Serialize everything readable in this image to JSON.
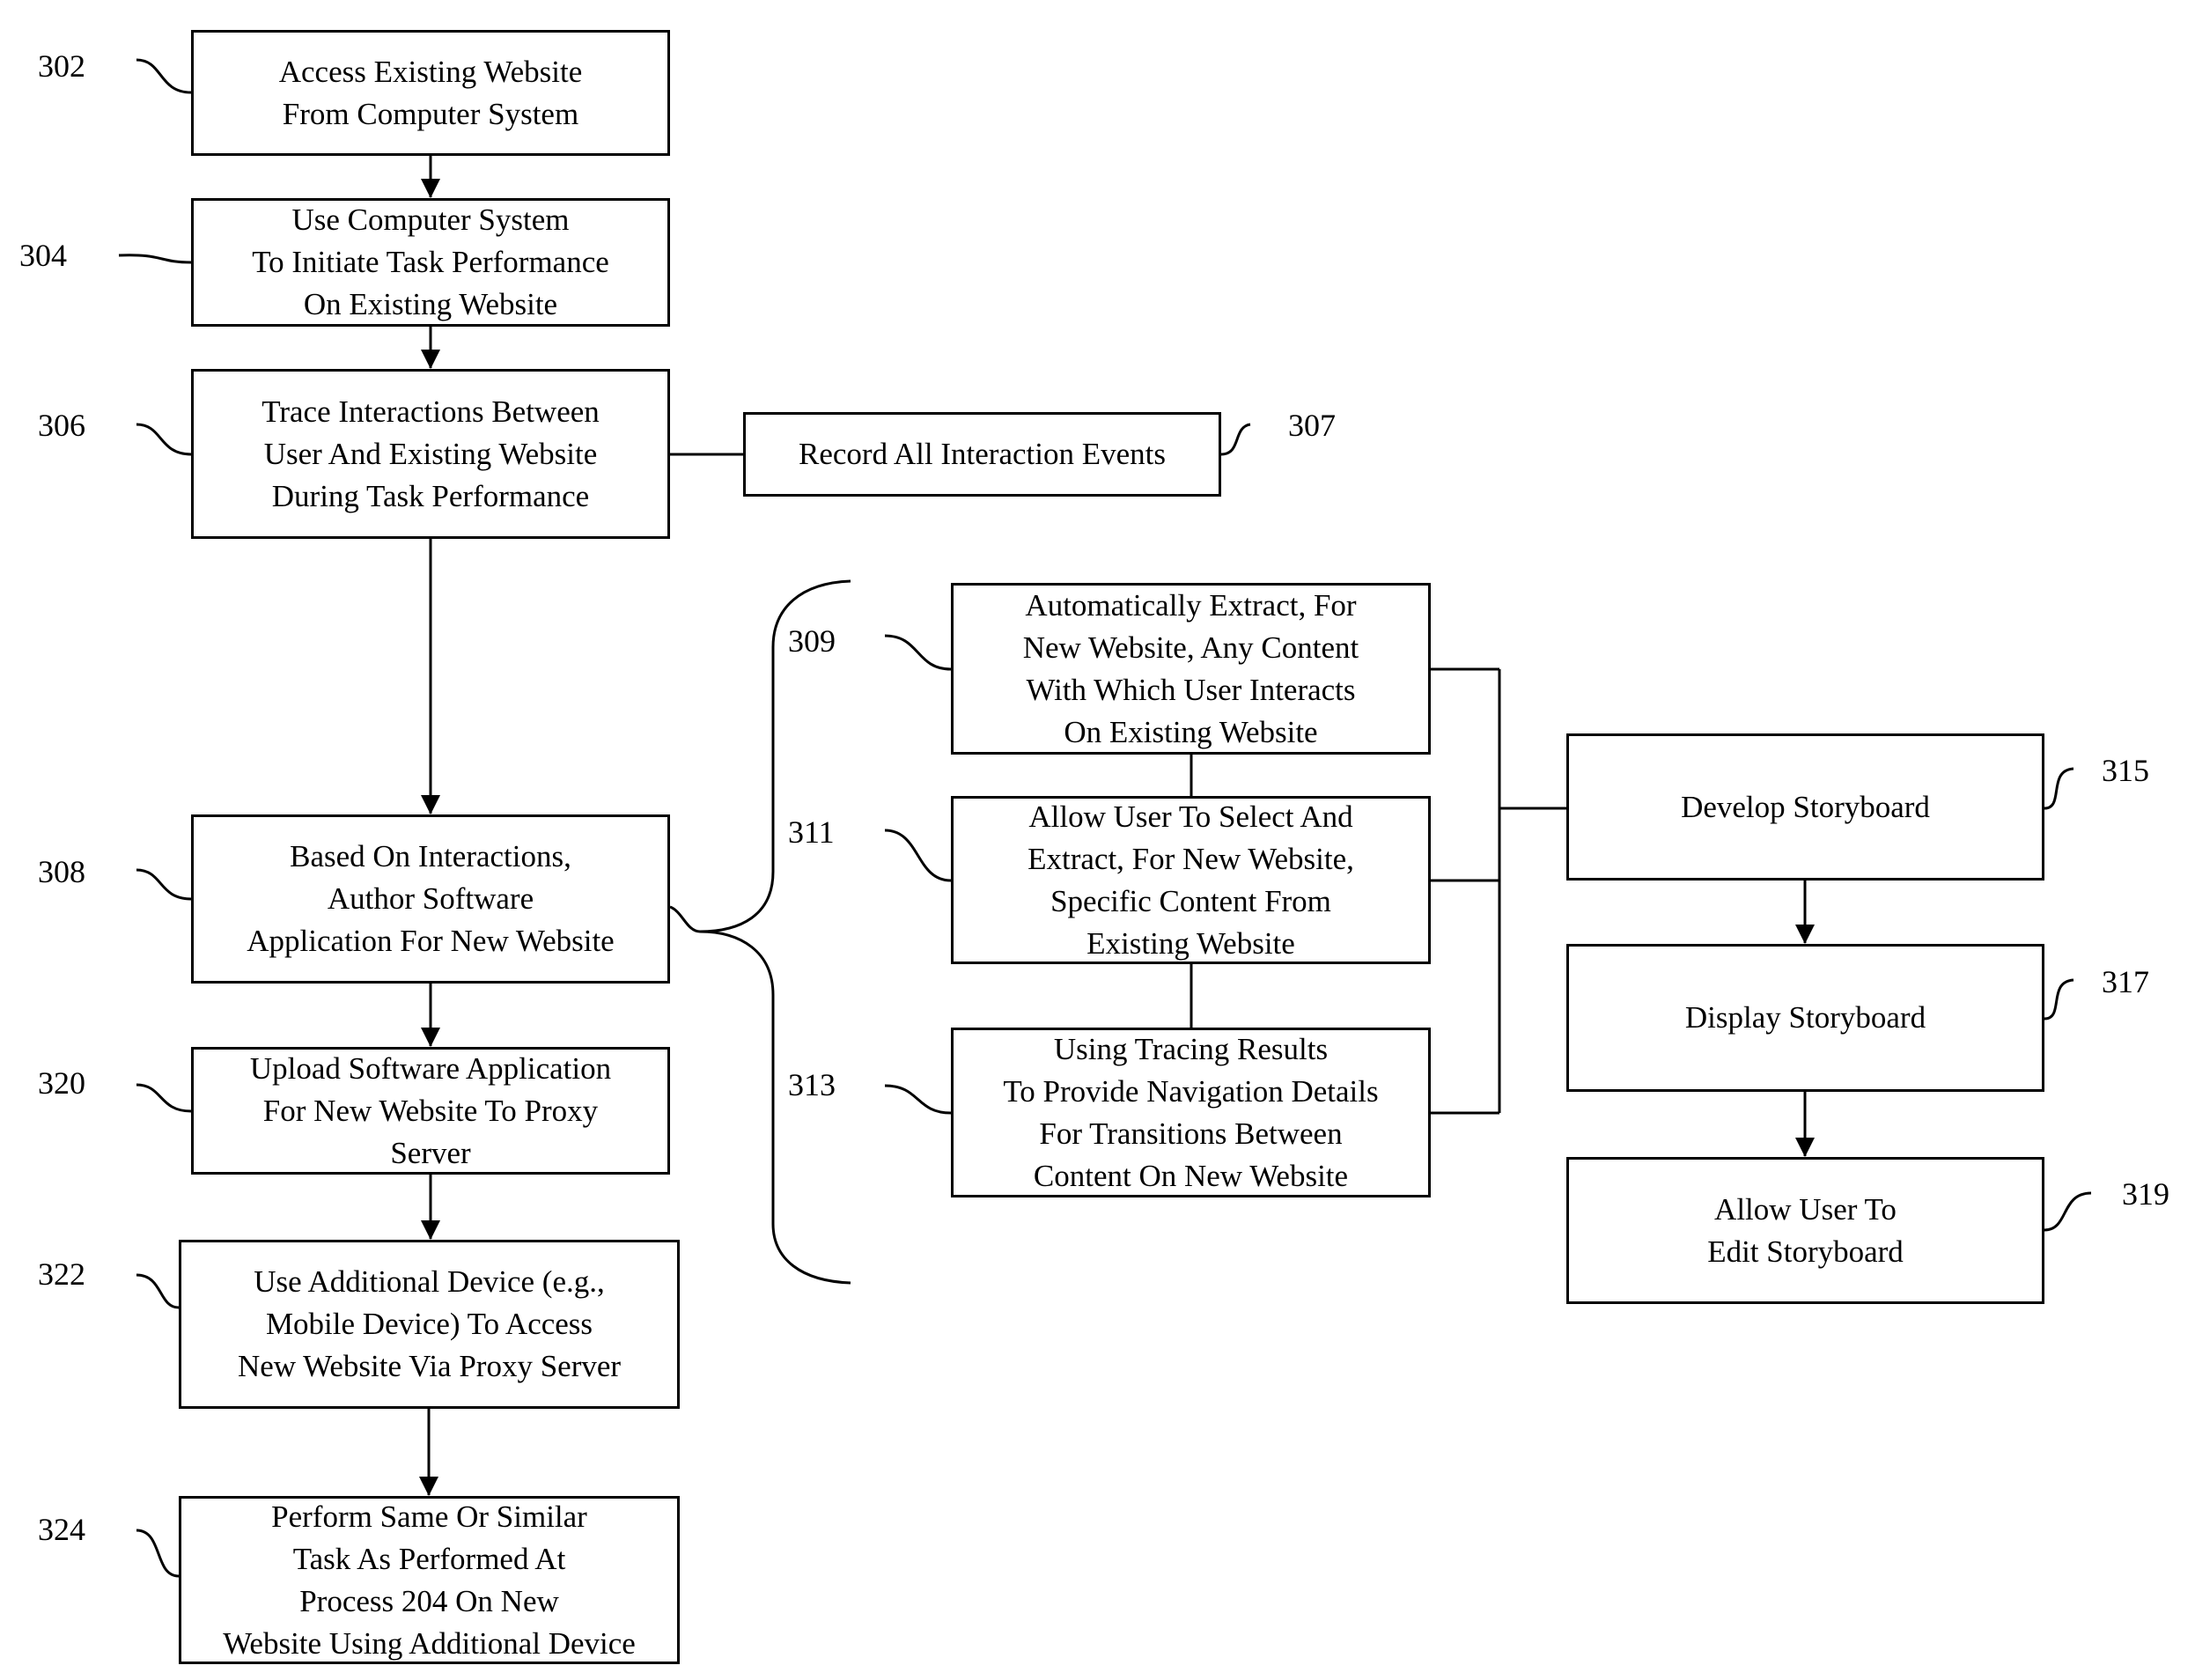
{
  "diagram": {
    "type": "flowchart",
    "steps": {
      "s302": {
        "ref": "302",
        "text": "Access Existing Website\nFrom Computer System"
      },
      "s304": {
        "ref": "304",
        "text": "Use Computer System\nTo Initiate Task Performance\nOn Existing Website"
      },
      "s306": {
        "ref": "306",
        "text": "Trace Interactions Between\nUser And Existing Website\nDuring Task Performance"
      },
      "s307": {
        "ref": "307",
        "text": "Record All Interaction Events"
      },
      "s308": {
        "ref": "308",
        "text": "Based On Interactions,\nAuthor Software\nApplication For New Website"
      },
      "s309": {
        "ref": "309",
        "text": "Automatically Extract, For\nNew Website, Any Content\nWith Which User Interacts\nOn Existing Website"
      },
      "s311": {
        "ref": "311",
        "text": "Allow User To Select And\nExtract, For New Website,\nSpecific Content From\nExisting Website"
      },
      "s313": {
        "ref": "313",
        "text": "Using Tracing Results\nTo Provide Navigation Details\nFor Transitions Between\nContent On New Website"
      },
      "s315": {
        "ref": "315",
        "text": "Develop Storyboard"
      },
      "s317": {
        "ref": "317",
        "text": "Display Storyboard"
      },
      "s319": {
        "ref": "319",
        "text": "Allow User To\nEdit Storyboard"
      },
      "s320": {
        "ref": "320",
        "text": "Upload Software Application\nFor New Website To Proxy\nServer"
      },
      "s322": {
        "ref": "322",
        "text": "Use Additional Device (e.g.,\nMobile Device) To Access\nNew Website Via Proxy Server"
      },
      "s324": {
        "ref": "324",
        "text": "Perform Same Or Similar\nTask As Performed At\nProcess 204 On New\nWebsite Using Additional Device"
      }
    },
    "edges": [
      {
        "from": "302",
        "to": "304",
        "arrow": true
      },
      {
        "from": "304",
        "to": "306",
        "arrow": true
      },
      {
        "from": "306",
        "to": "307",
        "arrow": false
      },
      {
        "from": "306",
        "to": "308",
        "arrow": true
      },
      {
        "from": "308",
        "to": "320",
        "arrow": true
      },
      {
        "from": "320",
        "to": "322",
        "arrow": true
      },
      {
        "from": "322",
        "to": "324",
        "arrow": true
      },
      {
        "from": "308",
        "to": "309/311/313",
        "arrow": false,
        "style": "brace"
      },
      {
        "from": "309",
        "to": "311",
        "arrow": false
      },
      {
        "from": "311",
        "to": "313",
        "arrow": false
      },
      {
        "from": "309/311/313",
        "to": "315",
        "arrow": false
      },
      {
        "from": "315",
        "to": "317",
        "arrow": true
      },
      {
        "from": "317",
        "to": "319",
        "arrow": true
      }
    ]
  }
}
